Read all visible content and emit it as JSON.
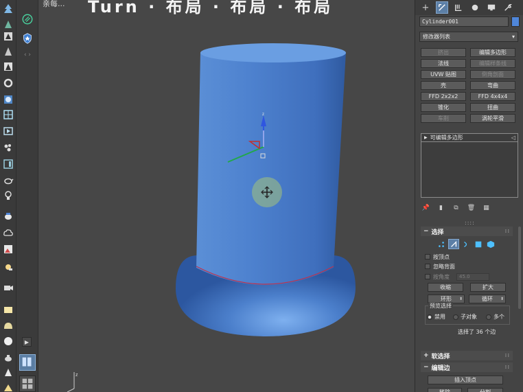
{
  "viewport": {
    "label": "亲每...",
    "overlay_text_fragment": "Turn · 布局 · 布局 · 布局"
  },
  "command_panel": {
    "tabs": [
      "create-icon",
      "modify-icon",
      "hierarchy-icon",
      "motion-icon",
      "display-icon",
      "utilities-icon"
    ],
    "object_name": "Cylinder001",
    "object_color": "#4f86d9",
    "modifier_list_label": "修改器列表",
    "modifier_buttons": [
      {
        "label": "挤出",
        "enabled": false
      },
      {
        "label": "编辑多边形",
        "enabled": true
      },
      {
        "label": "法线",
        "enabled": true
      },
      {
        "label": "编辑样条线",
        "enabled": false
      },
      {
        "label": "UVW 贴图",
        "enabled": true
      },
      {
        "label": "倒角剖面",
        "enabled": false
      },
      {
        "label": "壳",
        "enabled": true
      },
      {
        "label": "弯曲",
        "enabled": true
      },
      {
        "label": "FFD 2x2x2",
        "enabled": true
      },
      {
        "label": "FFD 4x4x4",
        "enabled": true
      },
      {
        "label": "锥化",
        "enabled": true
      },
      {
        "label": "扭曲",
        "enabled": true
      },
      {
        "label": "车削",
        "enabled": false
      },
      {
        "label": "涡轮平滑",
        "enabled": true
      }
    ],
    "stack_item": "可编辑多边形",
    "selection": {
      "header": "选择",
      "by_vertex": "按顶点",
      "ignore_backfacing": "忽略背面",
      "by_angle": "按角度",
      "angle_value": "45.0",
      "shrink": "收缩",
      "grow": "扩大",
      "ring": "环形",
      "loop": "循环",
      "preview_title": "预览选择",
      "preview_options": [
        "禁用",
        "子对象",
        "多个"
      ],
      "status": "选择了 36 个边"
    },
    "soft_selection_header": "软选择",
    "edit_edges": {
      "header": "编辑边",
      "insert_vertex": "插入顶点",
      "partial_labels": [
        "移除",
        "分割"
      ]
    }
  }
}
